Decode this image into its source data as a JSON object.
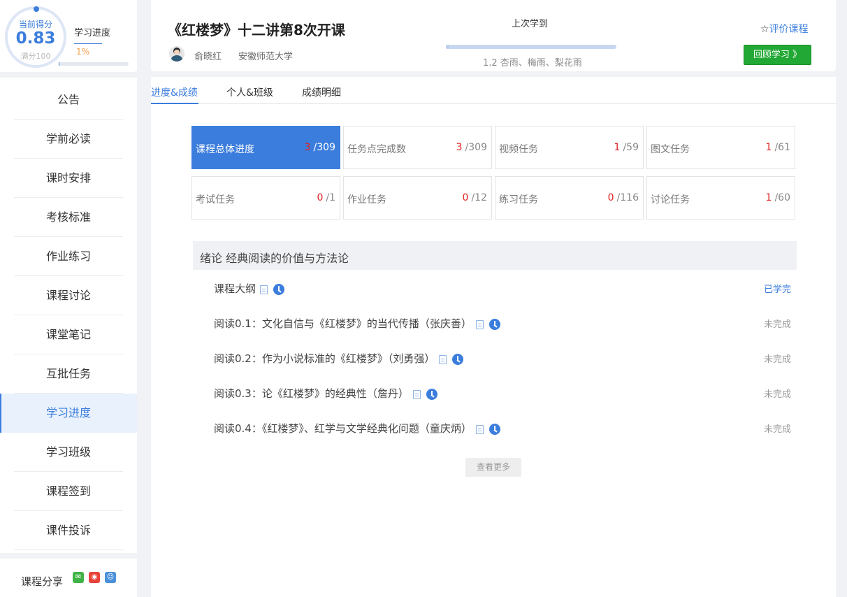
{
  "score": {
    "label": "当前得分",
    "value": "0.83",
    "full": "满分100"
  },
  "progress": {
    "label": "学习进度",
    "percent_text": "1%",
    "percent": 0.01
  },
  "nav": {
    "items": [
      "公告",
      "学前必读",
      "课时安排",
      "考核标准",
      "作业练习",
      "课程讨论",
      "课堂笔记",
      "互批任务",
      "学习进度",
      "学习班级",
      "课程签到",
      "课件投诉"
    ],
    "active": "学习进度"
  },
  "share": {
    "label": "课程分享",
    "icons": [
      "wechat-icon",
      "weibo-icon",
      "qq-icon"
    ]
  },
  "header": {
    "title": "《红楼梦》十二讲第8次开课",
    "teacher": "俞晓红",
    "school": "安徽师范大学",
    "last_label": "上次学到",
    "last_lesson": "1.2 杏雨、梅雨、梨花雨",
    "rate_label": "评价课程",
    "review_label": "回顾学习 》"
  },
  "tabs": [
    "进度&成绩",
    "个人&班级",
    "成绩明细"
  ],
  "stats": [
    {
      "label": "课程总体进度",
      "done": "3",
      "total": "/309"
    },
    {
      "label": "任务点完成数",
      "done": "3",
      "total": "/309"
    },
    {
      "label": "视频任务",
      "done": "1",
      "total": "/59"
    },
    {
      "label": "图文任务",
      "done": "1",
      "total": "/61"
    },
    {
      "label": "考试任务",
      "done": "0",
      "total": "/1"
    },
    {
      "label": "作业任务",
      "done": "0",
      "total": "/12"
    },
    {
      "label": "练习任务",
      "done": "0",
      "total": "/116"
    },
    {
      "label": "讨论任务",
      "done": "1",
      "total": "/60"
    }
  ],
  "chapter": {
    "title": "绪论 经典阅读的价值与方法论",
    "lessons": [
      {
        "title": "课程大纲",
        "status": "已学完"
      },
      {
        "title": "阅读0.1：文化自信与《红楼梦》的当代传播（张庆善）",
        "status": "未完成"
      },
      {
        "title": "阅读0.2：作为小说标准的《红楼梦》（刘勇强）",
        "status": "未完成"
      },
      {
        "title": "阅读0.3：论《红楼梦》的经典性（詹丹）",
        "status": "未完成"
      },
      {
        "title": "阅读0.4：《红楼梦》、红学与文学经典化问题（童庆炳）",
        "status": "未完成"
      }
    ]
  },
  "more_label": "查看更多",
  "colors": {
    "accent": "#3b7ddd",
    "green_button": "#22a834",
    "highlight_number": "#e02020",
    "progress_orange": "#f5a04a"
  }
}
